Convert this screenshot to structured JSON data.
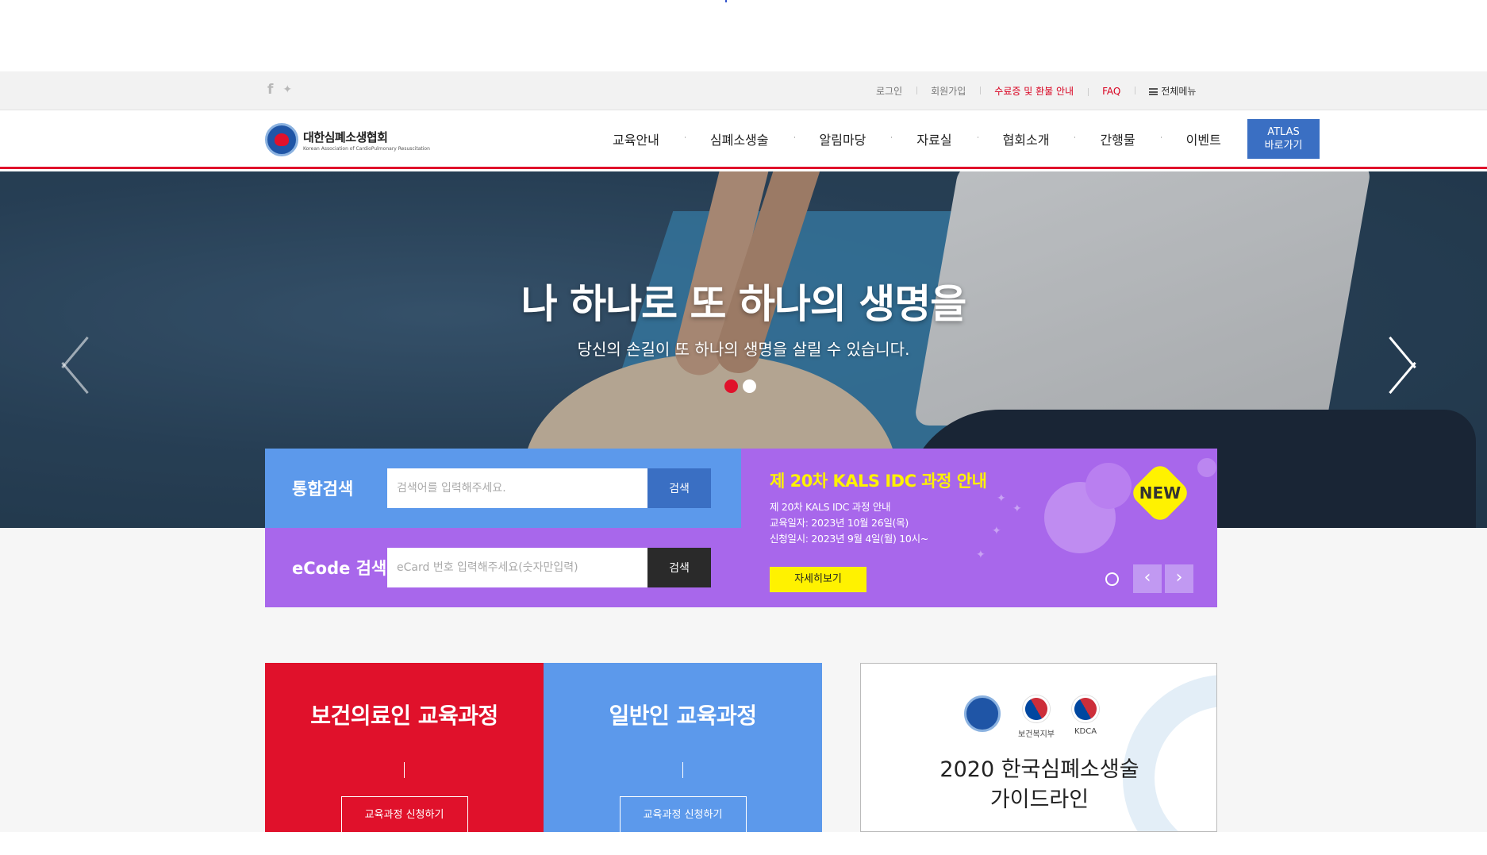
{
  "util": {
    "sns": [
      {
        "icon": "facebook-icon",
        "glyph": "f"
      },
      {
        "icon": "twitter-icon",
        "glyph": "🐦"
      }
    ],
    "links": [
      "로그인",
      "회원가입",
      "수료증 및 환불 안내",
      "FAQ"
    ],
    "all_menu": "전체메뉴"
  },
  "header": {
    "logo_ko": "대한심폐소생협회",
    "logo_en": "Korean Association of CardioPulmonary Resuscitation",
    "nav": [
      "교육안내",
      "심폐소생술",
      "알림마당",
      "자료실",
      "협회소개",
      "간행물",
      "이벤트"
    ],
    "atlas_line1": "ATLAS",
    "atlas_line2": "바로가기"
  },
  "hero": {
    "title": "나 하나로 또 하나의 생명을",
    "subtitle": "당신의 손길이 또 하나의 생명을 살릴 수 있습니다.",
    "slide_count": 2,
    "active_slide": 1
  },
  "search": {
    "integrated_label": "통합검색",
    "integrated_placeholder": "검색어를 입력해주세요.",
    "integrated_button": "검색",
    "ecode_label": "eCode 검색",
    "ecode_placeholder": "eCard 번호 입력해주세요(숫자만입력)",
    "ecode_button": "검색"
  },
  "notice": {
    "title": "제 20차 KALS IDC 과정 안내",
    "lines": [
      "제 20차 KALS IDC 과정 안내",
      "교육일자: 2023년 10월 26일(목)",
      "신청일시: 2023년 9월 4일(월) 10시~"
    ],
    "more": "자세히보기",
    "badge": "NEW",
    "prev": "‹",
    "next": "›"
  },
  "courses": [
    {
      "title": "보건의료인 교육과정",
      "button": "교육과정 신청하기"
    },
    {
      "title": "일반인 교육과정",
      "button": "교육과정 신청하기"
    }
  ],
  "guide": {
    "logos": [
      "보건복지부",
      "KDCA"
    ],
    "title_line1": "2020 한국심폐소생술",
    "title_line2": "가이드라인"
  },
  "colors": {
    "brand_red": "#e0112b",
    "blue": "#5c99eb",
    "purple": "#a867eb",
    "yellow": "#fff200",
    "atlas_blue": "#3a6fc3"
  }
}
